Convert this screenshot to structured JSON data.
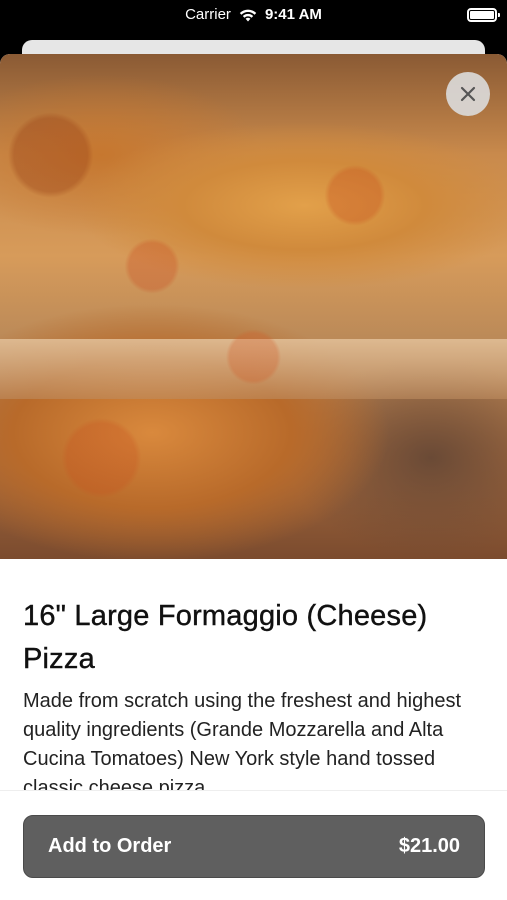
{
  "status_bar": {
    "carrier": "Carrier",
    "time": "9:41 AM",
    "icons": [
      "wifi-icon",
      "battery-icon"
    ]
  },
  "hero": {
    "image": "cheese-pizza-photo",
    "close_icon": "close-icon"
  },
  "item": {
    "title": "16\" Large Formaggio (Cheese) Pizza",
    "description": "Made from scratch using the freshest and highest quality ingredients (Grande Mozzarella and Alta Cucina Tomatoes) New York style hand tossed classic cheese pizza"
  },
  "footer": {
    "add_label": "Add to Order",
    "price": "$21.00"
  },
  "colors": {
    "button": "#5f5f5f",
    "background": "#ffffff"
  }
}
